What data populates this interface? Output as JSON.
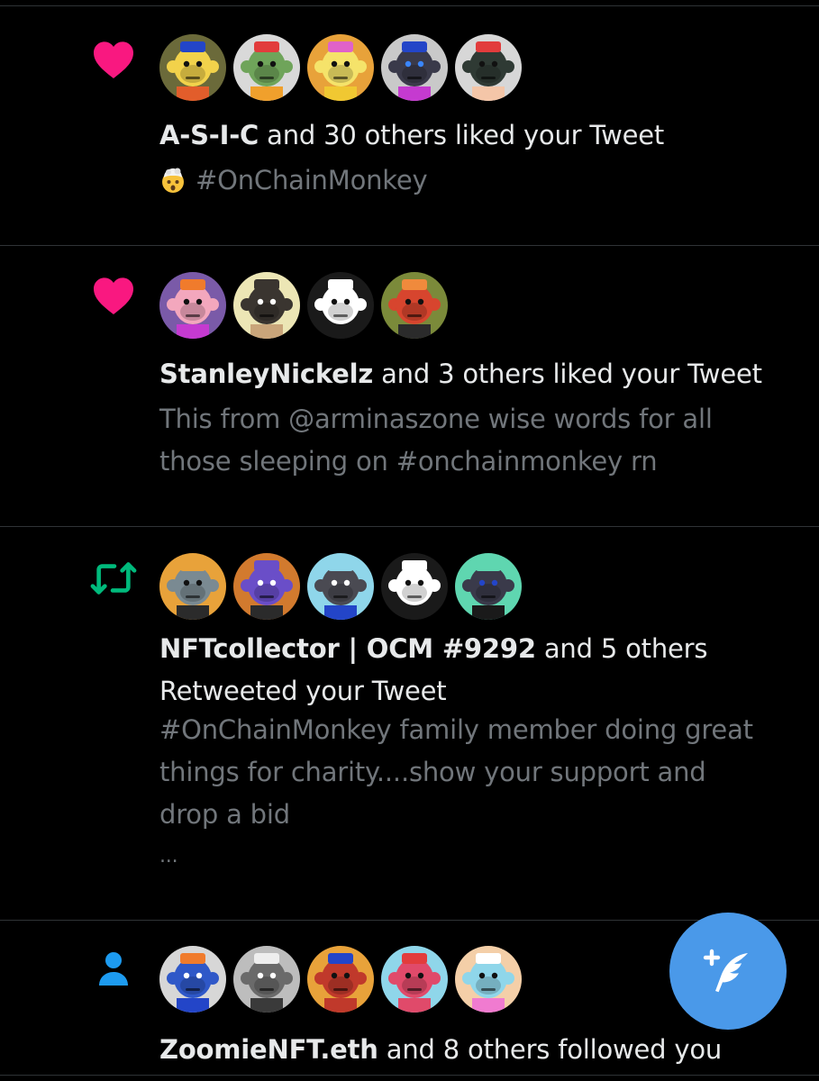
{
  "theme": {
    "background": "#000000",
    "text": "#e7e9ea",
    "muted": "#71767b",
    "like": "#f91880",
    "retweet": "#00ba7c",
    "follow": "#1d9bf0",
    "fab": "#4a99e9"
  },
  "notifications": [
    {
      "type": "like",
      "icon": "heart-icon",
      "avatars": [
        {
          "bg": "#6b6a3a",
          "face": "#f2d24b",
          "hat": "#2345c8",
          "body": "#e25d2b",
          "eyes": "#111"
        },
        {
          "bg": "#d9d9d9",
          "face": "#6fa45a",
          "hat": "#e23c3c",
          "body": "#f0a02c",
          "eyes": "#111"
        },
        {
          "bg": "#e8a23a",
          "face": "#f5e36a",
          "hat": "#e062c9",
          "body": "#f0c832",
          "eyes": "#111"
        },
        {
          "bg": "#c9c9c9",
          "face": "#3a3a4a",
          "hat": "#2345c8",
          "body": "#c53ad0",
          "eyes": "#3a86ff"
        },
        {
          "bg": "#d7d7d7",
          "face": "#2f3a34",
          "hat": "#e23c3c",
          "body": "#f4c6a8",
          "eyes": "#111"
        }
      ],
      "actor": "A-S-I-C",
      "summary": " and 30 others liked your Tweet",
      "tweet_lines": [
        "#OnChainMonkey"
      ],
      "emoji": "exploding-head-emoji"
    },
    {
      "type": "like",
      "icon": "heart-icon",
      "avatars": [
        {
          "bg": "#7a5aa8",
          "face": "#f3a7bd",
          "hat": "#f07b2c",
          "body": "#c53ad0",
          "eyes": "#111"
        },
        {
          "bg": "#ece6b5",
          "face": "#3a3530",
          "hat": "#3a3530",
          "body": "#c9a57a",
          "eyes": "#fff"
        },
        {
          "bg": "#1a1a1a",
          "face": "#ffffff",
          "hat": "#ffffff",
          "body": "#1a1a1a",
          "eyes": "#111"
        },
        {
          "bg": "#7b8a3a",
          "face": "#d7452e",
          "hat": "#f08a3c",
          "body": "#2b2b2b",
          "eyes": "#111"
        }
      ],
      "actor": "StanleyNickelz",
      "summary": " and 3 others liked your Tweet",
      "tweet_lines": [
        "This from @arminaszone wise words for all",
        "those sleeping on #onchainmonkey rn"
      ]
    },
    {
      "type": "retweet",
      "icon": "retweet-icon",
      "avatars": [
        {
          "bg": "#e8a23a",
          "face": "#7a8a92",
          "hat": "#e8a23a",
          "body": "#2b2b2b",
          "eyes": "#111"
        },
        {
          "bg": "#d27a2e",
          "face": "#6a4ec8",
          "hat": "#6a4ec8",
          "body": "#2b2b2b",
          "eyes": "#fff"
        },
        {
          "bg": "#8fd6ea",
          "face": "#4a4a52",
          "hat": "#8fd6ea",
          "body": "#2345c8",
          "eyes": "#fff"
        },
        {
          "bg": "#1a1a1a",
          "face": "#ffffff",
          "hat": "#ffffff",
          "body": "#1a1a1a",
          "eyes": "#111"
        },
        {
          "bg": "#5fd6b0",
          "face": "#3a3a4a",
          "hat": "#5fd6b0",
          "body": "#1a1a1a",
          "eyes": "#2345c8"
        }
      ],
      "actor": "NFTcollector | OCM #9292",
      "summary": " and 5 others",
      "summary_line2": "Retweeted your Tweet",
      "tweet_lines": [
        "#OnChainMonkey family member doing great",
        "things for charity....show your support and",
        "drop a bid",
        "..."
      ]
    },
    {
      "type": "follow",
      "icon": "person-icon",
      "avatars": [
        {
          "bg": "#d7d7d7",
          "face": "#2f58c8",
          "hat": "#f07b2c",
          "body": "#2345c8",
          "eyes": "#fff"
        },
        {
          "bg": "#bdbdbd",
          "face": "#6a6a6a",
          "hat": "#eeeeee",
          "body": "#3a3a3a",
          "eyes": "#fff"
        },
        {
          "bg": "#e8a23a",
          "face": "#c0392b",
          "hat": "#2345c8",
          "body": "#c0392b",
          "eyes": "#111"
        },
        {
          "bg": "#8fd6ea",
          "face": "#e04a6a",
          "hat": "#e23c3c",
          "body": "#e04a6a",
          "eyes": "#111"
        },
        {
          "bg": "#f4cfa8",
          "face": "#8fd6ea",
          "hat": "#ffffff",
          "body": "#f07bd0",
          "eyes": "#111"
        }
      ],
      "actor": "ZoomieNFT.eth",
      "summary": " and 8 others followed you"
    }
  ],
  "compose": {
    "icon": "compose-tweet-icon"
  }
}
